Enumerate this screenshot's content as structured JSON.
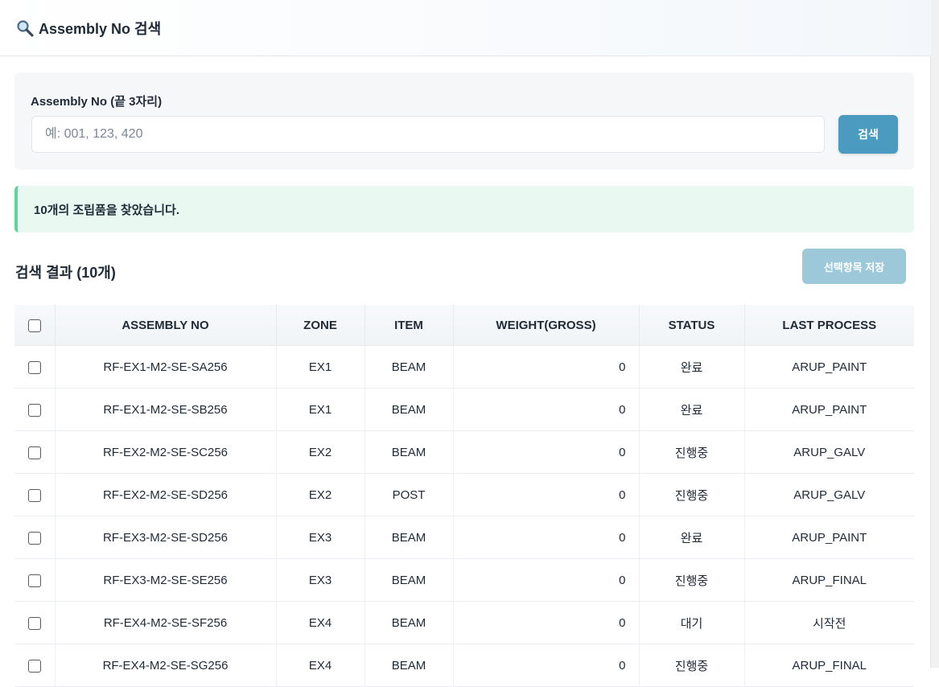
{
  "header": {
    "title": "Assembly No 검색",
    "icon": "search-icon"
  },
  "search": {
    "label": "Assembly No (끝 3자리)",
    "placeholder": "예: 001, 123, 420",
    "value": "",
    "button_label": "검색"
  },
  "alert": {
    "message": "10개의 조립품을 찾았습니다."
  },
  "results": {
    "title": "검색 결과 (10개)",
    "save_button": "선택항목 저장",
    "columns": [
      "ASSEMBLY NO",
      "ZONE",
      "ITEM",
      "WEIGHT(GROSS)",
      "STATUS",
      "LAST PROCESS"
    ],
    "rows": [
      {
        "assembly_no": "RF-EX1-M2-SE-SA256",
        "zone": "EX1",
        "item": "BEAM",
        "weight": "0",
        "status": "완료",
        "last_process": "ARUP_PAINT"
      },
      {
        "assembly_no": "RF-EX1-M2-SE-SB256",
        "zone": "EX1",
        "item": "BEAM",
        "weight": "0",
        "status": "완료",
        "last_process": "ARUP_PAINT"
      },
      {
        "assembly_no": "RF-EX2-M2-SE-SC256",
        "zone": "EX2",
        "item": "BEAM",
        "weight": "0",
        "status": "진행중",
        "last_process": "ARUP_GALV"
      },
      {
        "assembly_no": "RF-EX2-M2-SE-SD256",
        "zone": "EX2",
        "item": "POST",
        "weight": "0",
        "status": "진행중",
        "last_process": "ARUP_GALV"
      },
      {
        "assembly_no": "RF-EX3-M2-SE-SD256",
        "zone": "EX3",
        "item": "BEAM",
        "weight": "0",
        "status": "완료",
        "last_process": "ARUP_PAINT"
      },
      {
        "assembly_no": "RF-EX3-M2-SE-SE256",
        "zone": "EX3",
        "item": "BEAM",
        "weight": "0",
        "status": "진행중",
        "last_process": "ARUP_FINAL"
      },
      {
        "assembly_no": "RF-EX4-M2-SE-SF256",
        "zone": "EX4",
        "item": "BEAM",
        "weight": "0",
        "status": "대기",
        "last_process": "시작전"
      },
      {
        "assembly_no": "RF-EX4-M2-SE-SG256",
        "zone": "EX4",
        "item": "BEAM",
        "weight": "0",
        "status": "진행중",
        "last_process": "ARUP_FINAL"
      }
    ]
  },
  "colors": {
    "primary_button": "#4a9bbf",
    "disabled_button": "#9cc8da",
    "success_border": "#5fd49a",
    "success_bg": "#e9f8f0"
  }
}
